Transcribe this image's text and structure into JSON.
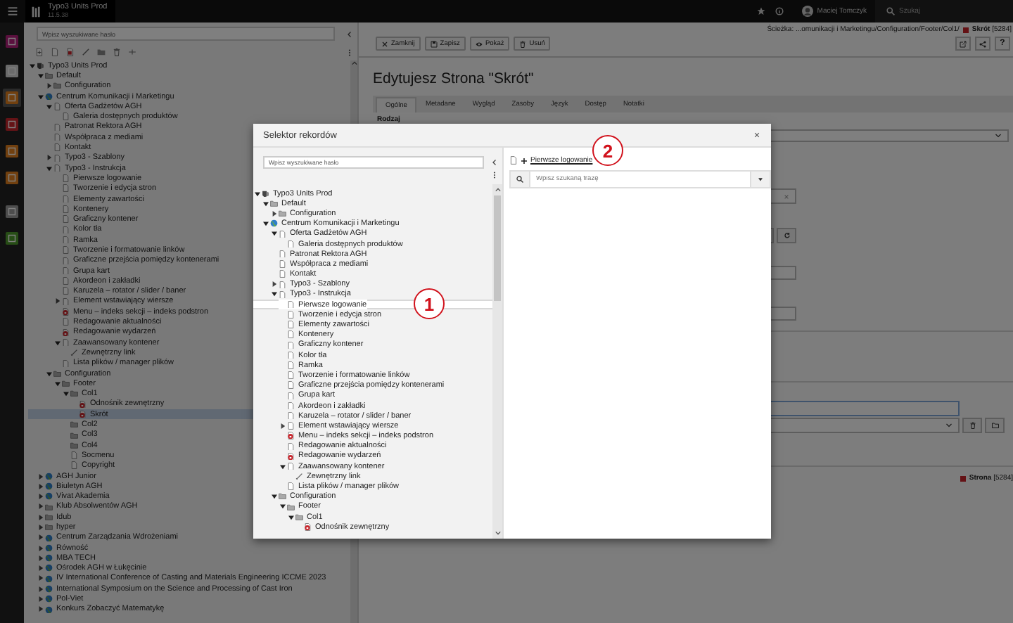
{
  "topbar": {
    "app_name": "Typo3 Units Prod",
    "version": "11.5.38",
    "user": "Maciej Tomczyk",
    "search_placeholder": "Szukaj"
  },
  "modules": [
    {
      "selected": false
    },
    {
      "selected": false
    },
    {
      "selected": true
    },
    {
      "selected": false
    },
    {
      "selected": false
    },
    {
      "selected": false
    },
    {
      "selected": false
    },
    {
      "selected": false
    }
  ],
  "page_tree": {
    "search_placeholder": "Wpisz wyszukiwane hasło",
    "nodes": [
      {
        "label": "Typo3 Units Prod",
        "kind": "root",
        "selected": false,
        "expanded": true,
        "children": [
          {
            "label": "Default",
            "kind": "folder",
            "selected": false,
            "expanded": true,
            "children": [
              {
                "label": "Configuration",
                "kind": "folder",
                "selected": false,
                "expanded": false
              }
            ]
          },
          {
            "label": "Centrum Komunikacji i Marketingu",
            "kind": "site",
            "selected": false,
            "expanded": true,
            "children": [
              {
                "label": "Oferta Gadżetów AGH",
                "kind": "page",
                "selected": false,
                "expanded": true,
                "children": [
                  {
                    "label": "Galeria dostępnych produktów",
                    "kind": "page",
                    "selected": false
                  }
                ]
              },
              {
                "label": "Patronat Rektora AGH",
                "kind": "page",
                "selected": false
              },
              {
                "label": "Współpraca z mediami",
                "kind": "page",
                "selected": false
              },
              {
                "label": "Kontakt",
                "kind": "page",
                "selected": false
              },
              {
                "label": "Typo3 - Szablony",
                "kind": "page",
                "selected": false,
                "expanded": false
              },
              {
                "label": "Typo3 - Instrukcja",
                "kind": "page",
                "selected": false,
                "expanded": true,
                "children": [
                  {
                    "label": "Pierwsze logowanie",
                    "kind": "page",
                    "selected": false
                  },
                  {
                    "label": "Tworzenie i edycja stron",
                    "kind": "page",
                    "selected": false
                  },
                  {
                    "label": "Elementy zawartości",
                    "kind": "page",
                    "selected": false
                  },
                  {
                    "label": "Kontenery",
                    "kind": "page",
                    "selected": false
                  },
                  {
                    "label": "Graficzny kontener",
                    "kind": "page",
                    "selected": false
                  },
                  {
                    "label": "Kolor tła",
                    "kind": "page",
                    "selected": false
                  },
                  {
                    "label": "Ramka",
                    "kind": "page",
                    "selected": false
                  },
                  {
                    "label": "Tworzenie i formatowanie linków",
                    "kind": "page",
                    "selected": false
                  },
                  {
                    "label": "Graficzne przejścia pomiędzy kontenerami",
                    "kind": "page",
                    "selected": false
                  },
                  {
                    "label": "Grupa kart",
                    "kind": "page",
                    "selected": false
                  },
                  {
                    "label": "Akordeon i zakładki",
                    "kind": "page",
                    "selected": false
                  },
                  {
                    "label": "Karuzela – rotator / slider / baner",
                    "kind": "page",
                    "selected": false
                  },
                  {
                    "label": "Element wstawiający wiersze",
                    "kind": "page",
                    "selected": false,
                    "expanded": false
                  },
                  {
                    "label": "Menu – indeks sekcji – indeks podstron",
                    "kind": "restricted",
                    "selected": false
                  },
                  {
                    "label": "Redagowanie aktualności",
                    "kind": "page",
                    "selected": false
                  },
                  {
                    "label": "Redagowanie wydarzeń",
                    "kind": "restricted",
                    "selected": false
                  },
                  {
                    "label": "Zaawansowany kontener",
                    "kind": "page",
                    "selected": false,
                    "expanded": true,
                    "children": [
                      {
                        "label": "Zewnętrzny link",
                        "kind": "link",
                        "selected": false
                      }
                    ]
                  },
                  {
                    "label": "Lista plików / manager plików",
                    "kind": "page",
                    "selected": false
                  }
                ]
              },
              {
                "label": "Configuration",
                "kind": "folder",
                "selected": false,
                "expanded": true,
                "children": [
                  {
                    "label": "Footer",
                    "kind": "folder",
                    "selected": false,
                    "expanded": true,
                    "children": [
                      {
                        "label": "Col1",
                        "kind": "folder",
                        "selected": false,
                        "expanded": true,
                        "children": [
                          {
                            "label": "Odnośnik zewnętrzny",
                            "kind": "restricted",
                            "selected": false
                          },
                          {
                            "label": "Skrót",
                            "kind": "restricted",
                            "selected": true
                          }
                        ]
                      },
                      {
                        "label": "Col2",
                        "kind": "folder",
                        "selected": false
                      },
                      {
                        "label": "Col3",
                        "kind": "folder",
                        "selected": false
                      },
                      {
                        "label": "Col4",
                        "kind": "folder",
                        "selected": false
                      },
                      {
                        "label": "Socmenu",
                        "kind": "page",
                        "selected": false
                      },
                      {
                        "label": "Copyright",
                        "kind": "page",
                        "selected": false
                      }
                    ]
                  }
                ]
              }
            ]
          },
          {
            "label": "AGH Junior",
            "kind": "site",
            "selected": false,
            "expanded": false
          },
          {
            "label": "Biuletyn AGH",
            "kind": "site",
            "selected": false,
            "expanded": false
          },
          {
            "label": "Vivat Akademia",
            "kind": "site",
            "selected": false,
            "expanded": false
          },
          {
            "label": "Klub Absolwentów AGH",
            "kind": "folder",
            "selected": false,
            "expanded": false
          },
          {
            "label": "Idub",
            "kind": "folder",
            "selected": false,
            "expanded": false
          },
          {
            "label": "hyper",
            "kind": "folder",
            "selected": false,
            "expanded": false
          },
          {
            "label": "Centrum Zarządzania Wdrożeniami",
            "kind": "site",
            "selected": false,
            "expanded": false
          },
          {
            "label": "Równość",
            "kind": "site",
            "selected": false,
            "expanded": false
          },
          {
            "label": "MBA TECH",
            "kind": "site",
            "selected": false,
            "expanded": false
          },
          {
            "label": "Ośrodek AGH w Łukęcinie",
            "kind": "site",
            "selected": false,
            "expanded": false
          },
          {
            "label": "IV International Conference of Casting and Materials Engineering ICCME 2023",
            "kind": "site",
            "selected": false,
            "expanded": false
          },
          {
            "label": "International Symposium on the Science and Processing of Cast Iron",
            "kind": "site",
            "selected": false,
            "expanded": false
          },
          {
            "label": "Pol-Viet",
            "kind": "site",
            "selected": false,
            "expanded": false
          },
          {
            "label": "Konkurs Zobaczyć Matematykę",
            "kind": "site",
            "selected": false,
            "expanded": false
          }
        ]
      }
    ]
  },
  "editor": {
    "path": "Ścieżka: ...omunikacji i Marketingu/Configuration/Footer/Col1/",
    "record": "**Skrót** [5284]",
    "buttons": [
      {
        "label": "Zamknij",
        "kind": "close"
      },
      {
        "label": "Zapisz",
        "kind": "save"
      },
      {
        "label": "Pokaż",
        "kind": "view"
      },
      {
        "label": "Usuń",
        "kind": "delete"
      }
    ],
    "help_label": "?",
    "title": "Edytujesz Strona \"Skrót\"",
    "tabs": [
      {
        "label": "Ogólne",
        "selected": true
      },
      {
        "label": "Metadane",
        "selected": false
      },
      {
        "label": "Wygląd",
        "selected": false
      },
      {
        "label": "Zasoby",
        "selected": false
      },
      {
        "label": "Język",
        "selected": false
      },
      {
        "label": "Dostęp",
        "selected": false
      },
      {
        "label": "Notatki",
        "selected": false
      }
    ],
    "field_label": "Rodzaj",
    "record_ref": "**Strona** [5284]"
  },
  "modal": {
    "title": "Selektor rekordów",
    "search_placeholder": "Wpisz wyszukiwane hasło",
    "nodes": [
      {
        "label": "Typo3 Units Prod",
        "kind": "root",
        "selected": false,
        "expanded": true,
        "children": [
          {
            "label": "Default",
            "kind": "folder",
            "selected": false,
            "expanded": true,
            "children": [
              {
                "label": "Configuration",
                "kind": "folder",
                "selected": false,
                "expanded": false
              }
            ]
          },
          {
            "label": "Centrum Komunikacji i Marketingu",
            "kind": "site",
            "selected": false,
            "expanded": true,
            "children": [
              {
                "label": "Oferta Gadżetów AGH",
                "kind": "page",
                "selected": false,
                "expanded": true,
                "children": [
                  {
                    "label": "Galeria dostępnych produktów",
                    "kind": "page",
                    "selected": false
                  }
                ]
              },
              {
                "label": "Patronat Rektora AGH",
                "kind": "page",
                "selected": false
              },
              {
                "label": "Współpraca z mediami",
                "kind": "page",
                "selected": false
              },
              {
                "label": "Kontakt",
                "kind": "page",
                "selected": false
              },
              {
                "label": "Typo3 - Szablony",
                "kind": "page",
                "selected": false,
                "expanded": false
              },
              {
                "label": "Typo3 - Instrukcja",
                "kind": "page",
                "selected": false,
                "expanded": true,
                "children": [
                  {
                    "label": "Pierwsze logowanie",
                    "kind": "page",
                    "selected": true
                  },
                  {
                    "label": "Tworzenie i edycja stron",
                    "kind": "page",
                    "selected": false
                  },
                  {
                    "label": "Elementy zawartości",
                    "kind": "page",
                    "selected": false
                  },
                  {
                    "label": "Kontenery",
                    "kind": "page",
                    "selected": false
                  },
                  {
                    "label": "Graficzny kontener",
                    "kind": "page",
                    "selected": false
                  },
                  {
                    "label": "Kolor tła",
                    "kind": "page",
                    "selected": false
                  },
                  {
                    "label": "Ramka",
                    "kind": "page",
                    "selected": false
                  },
                  {
                    "label": "Tworzenie i formatowanie linków",
                    "kind": "page",
                    "selected": false
                  },
                  {
                    "label": "Graficzne przejścia pomiędzy kontenerami",
                    "kind": "page",
                    "selected": false
                  },
                  {
                    "label": "Grupa kart",
                    "kind": "page",
                    "selected": false
                  },
                  {
                    "label": "Akordeon i zakładki",
                    "kind": "page",
                    "selected": false
                  },
                  {
                    "label": "Karuzela – rotator / slider / baner",
                    "kind": "page",
                    "selected": false
                  },
                  {
                    "label": "Element wstawiający wiersze",
                    "kind": "page",
                    "selected": false,
                    "expanded": false
                  },
                  {
                    "label": "Menu – indeks sekcji – indeks podstron",
                    "kind": "restricted",
                    "selected": false
                  },
                  {
                    "label": "Redagowanie aktualności",
                    "kind": "page",
                    "selected": false
                  },
                  {
                    "label": "Redagowanie wydarzeń",
                    "kind": "restricted",
                    "selected": false
                  },
                  {
                    "label": "Zaawansowany kontener",
                    "kind": "page",
                    "selected": false,
                    "expanded": true,
                    "children": [
                      {
                        "label": "Zewnętrzny link",
                        "kind": "link",
                        "selected": false
                      }
                    ]
                  },
                  {
                    "label": "Lista plików / manager plików",
                    "kind": "page",
                    "selected": false
                  }
                ]
              },
              {
                "label": "Configuration",
                "kind": "folder",
                "selected": false,
                "expanded": true,
                "children": [
                  {
                    "label": "Footer",
                    "kind": "folder",
                    "selected": false,
                    "expanded": true,
                    "children": [
                      {
                        "label": "Col1",
                        "kind": "folder",
                        "selected": false,
                        "expanded": true,
                        "children": [
                          {
                            "label": "Odnośnik zewnętrzny",
                            "kind": "restricted",
                            "selected": false
                          }
                        ]
                      }
                    ]
                  }
                ]
              }
            ]
          }
        ]
      }
    ],
    "selected_link": "Pierwsze logowanie",
    "filter_placeholder": "Wpisz szukaną frazę"
  },
  "annotations": [
    {
      "label": "1"
    },
    {
      "label": "2"
    }
  ]
}
